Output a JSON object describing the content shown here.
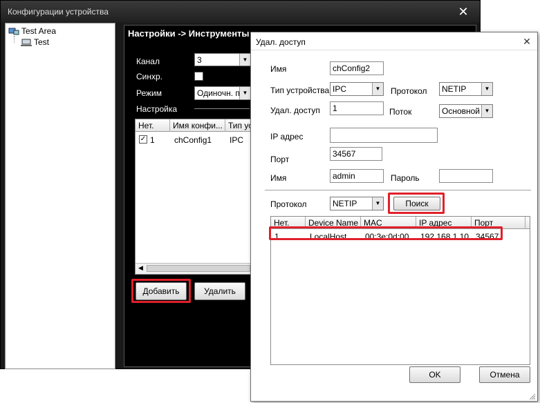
{
  "main_window": {
    "title": "Конфигурации устройства",
    "close_glyph": "✕"
  },
  "tree": {
    "root_label": "Test Area",
    "child_label": "Test"
  },
  "settings": {
    "title": "Настройки -> Инструменты",
    "channel_label": "Канал",
    "channel_value": "3",
    "sync_label": "Синхр.",
    "mode_label": "Режим",
    "mode_value": "Одиночн. под",
    "setup_label": "Настройка",
    "grid": {
      "headers": [
        "Нет.",
        "Имя конфи...",
        "Тип усг"
      ],
      "row": {
        "num": "1",
        "name": "chConfig1",
        "type": "IPC"
      }
    },
    "add_button": "Добавить",
    "delete_button": "Удалить"
  },
  "dialog": {
    "title": "Удал. доступ",
    "close_glyph": "✕",
    "name_label": "Имя",
    "name_value": "chConfig2",
    "device_type_label": "Тип устройства",
    "device_type_value": "IPC",
    "protocol_label": "Протокол",
    "protocol_value": "NETIP",
    "remote_label": "Удал. доступ",
    "remote_value": "1",
    "stream_label": "Поток",
    "stream_value": "Основной г",
    "ip_label": "IP адрес",
    "ip_value": "",
    "port_label": "Порт",
    "port_value": "34567",
    "user_label": "Имя",
    "user_value": "admin",
    "password_label": "Пароль",
    "password_value": "",
    "search_protocol_label": "Протокол",
    "search_protocol_value": "NETIP",
    "search_button": "Поиск",
    "grid": {
      "headers": [
        "Нет.",
        "Device Name",
        "MAC",
        "IP адрес",
        "Порт"
      ],
      "rows": [
        {
          "num": "1",
          "name": "LocalHost",
          "mac": "00:3e:0d:00...",
          "ip": "192.168.1.10",
          "port": "34567"
        }
      ]
    },
    "ok_button": "OK",
    "cancel_button": "Отмена"
  },
  "colors": {
    "highlight": "#e0202a",
    "dark_bg": "#1a1a1a"
  }
}
